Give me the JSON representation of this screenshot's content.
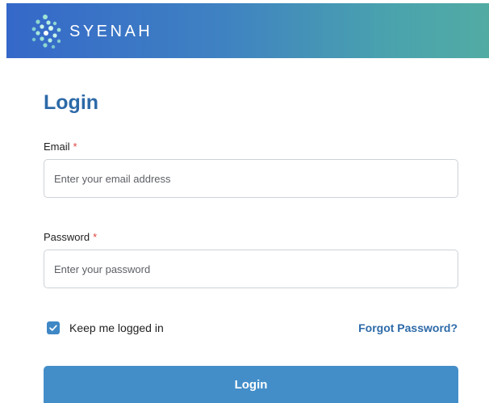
{
  "brand": {
    "name": "SYENAH",
    "icon": "dna-dots-logo-icon",
    "gradient_colors": [
      "#3568c9",
      "#52aba3"
    ]
  },
  "form": {
    "title": "Login",
    "email": {
      "label": "Email",
      "required_mark": "*",
      "placeholder": "Enter your email address",
      "value": ""
    },
    "password": {
      "label": "Password",
      "required_mark": "*",
      "placeholder": "Enter your password",
      "value": ""
    },
    "keep_logged_in": {
      "label": "Keep me logged in",
      "checked": true
    },
    "forgot_password": "Forgot Password?",
    "submit_label": "Login"
  },
  "colors": {
    "accent": "#2d6aa8",
    "button": "#438ec9",
    "required": "#e0443f"
  }
}
